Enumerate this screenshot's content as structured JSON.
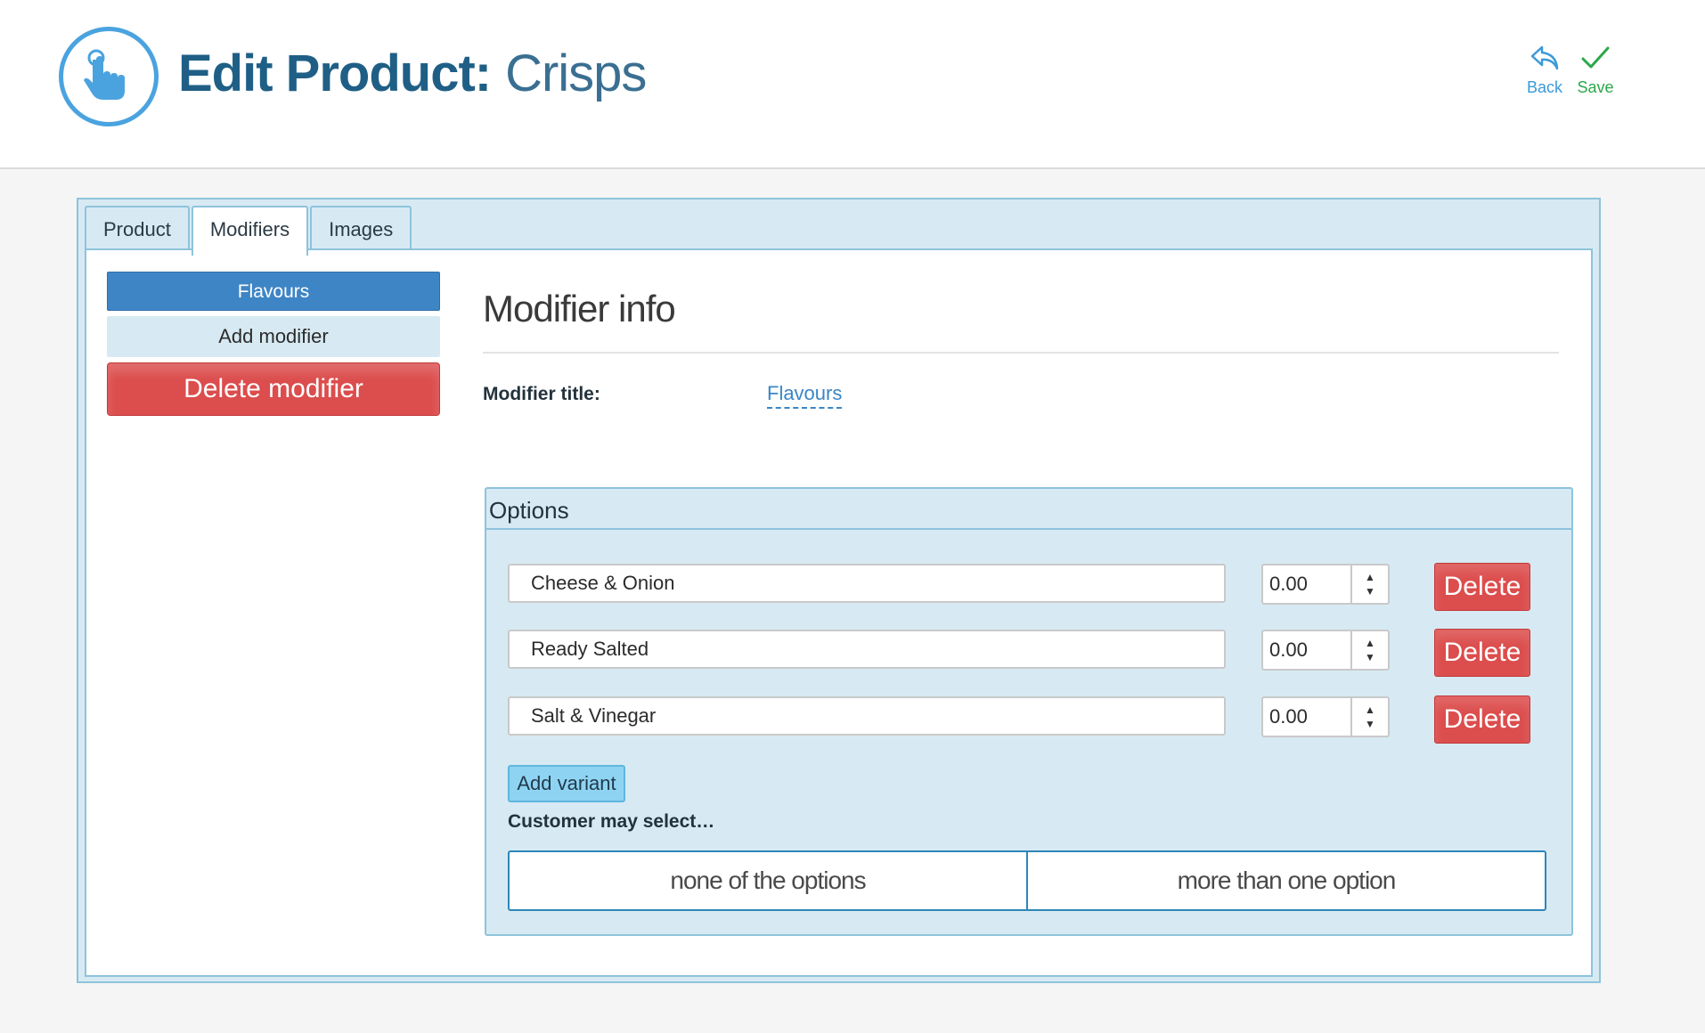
{
  "header": {
    "title_bold": "Edit Product:",
    "title_light": "Crisps",
    "logo_icon": "pointing-hand-icon",
    "back_label": "Back",
    "save_label": "Save",
    "back_icon": "reply-arrow-icon",
    "save_icon": "checkmark-icon"
  },
  "tabs": [
    {
      "label": "Product",
      "active": false
    },
    {
      "label": "Modifiers",
      "active": true
    },
    {
      "label": "Images",
      "active": false
    }
  ],
  "modifiers_sidebar": {
    "selected_modifier": "Flavours",
    "add_label": "Add modifier",
    "delete_label": "Delete modifier"
  },
  "modifier_info": {
    "heading": "Modifier info",
    "title_label": "Modifier title:",
    "title_value": "Flavours"
  },
  "options": {
    "heading": "Options",
    "rows": [
      {
        "name": "Cheese & Onion",
        "price": "0.00",
        "delete_label": "Delete"
      },
      {
        "name": "Ready Salted",
        "price": "0.00",
        "delete_label": "Delete"
      },
      {
        "name": "Salt & Vinegar",
        "price": "0.00",
        "delete_label": "Delete"
      }
    ],
    "add_variant_label": "Add variant",
    "customer_select_label": "Customer may select…",
    "select_none_label": "none of the options",
    "select_multiple_label": "more than one option"
  },
  "colors": {
    "accent_blue": "#3e85c6",
    "title_blue": "#1f5f86",
    "danger_red": "#dc4d4d",
    "save_green": "#2aa84a",
    "panel_bg": "#d7eaf3"
  }
}
